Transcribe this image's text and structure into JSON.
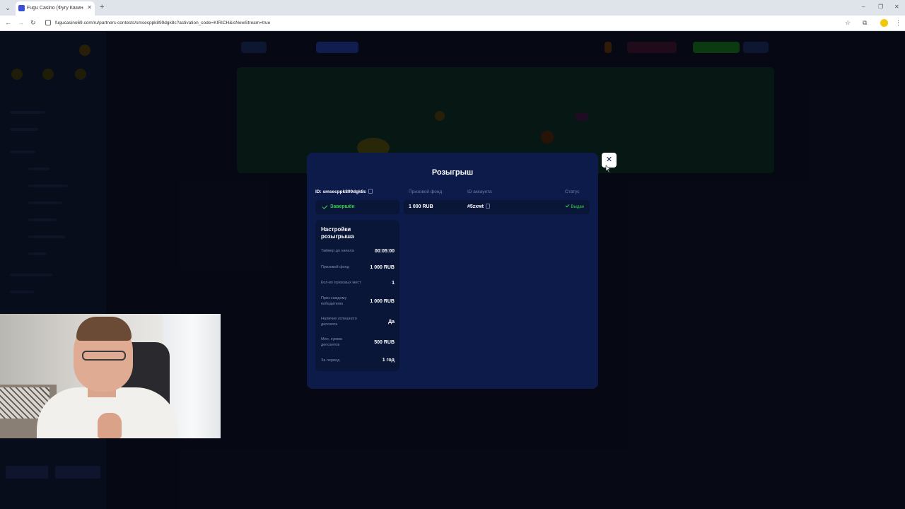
{
  "browser": {
    "tab_title": "Fugu Casino (Фугу Казино) - р...",
    "url": "fugucasino69.com/ru/partners-contests/smsecppk899dgk8c?activation_code=KIRICH&isNewStream=true"
  },
  "modal": {
    "title": "Розыгрыш",
    "id_label": "ID: smsecppk899dgk8c",
    "status_pill": "Завершён",
    "columns": {
      "prize_fund": "Призовой фонд",
      "account_id": "ID аккаунта",
      "status": "Статус"
    },
    "row": {
      "prize_fund": "1 000 RUB",
      "account_id": "#5zxwt",
      "status": "Выдан"
    },
    "settings": {
      "title": "Настройки розыгрыша",
      "items": [
        {
          "label": "Таймер до начала",
          "value": "00:05:00"
        },
        {
          "label": "Призовой фонд",
          "value": "1 000 RUB"
        },
        {
          "label": "Кол-во призовых мест",
          "value": "1"
        },
        {
          "label": "Приз каждому победителю",
          "value": "1 000 RUB"
        },
        {
          "label": "Наличие успешного депозита",
          "value": "Да"
        },
        {
          "label": "Мин. сумма депозитов",
          "value": "500 RUB"
        },
        {
          "label": "За период",
          "value": "1 год"
        }
      ]
    }
  },
  "colors": {
    "modal_bg": "#0c1b49",
    "success": "#35d04b",
    "muted_text": "#6e7ca6"
  },
  "icons": [
    "tab-menu-icon",
    "favicon-icon",
    "close-tab-icon",
    "new-tab-icon",
    "back-icon",
    "forward-icon",
    "reload-icon",
    "site-info-icon",
    "bookmark-star-icon",
    "extensions-icon",
    "profile-icon",
    "browser-menu-icon",
    "copy-icon",
    "check-icon",
    "close-icon",
    "cursor-icon"
  ]
}
